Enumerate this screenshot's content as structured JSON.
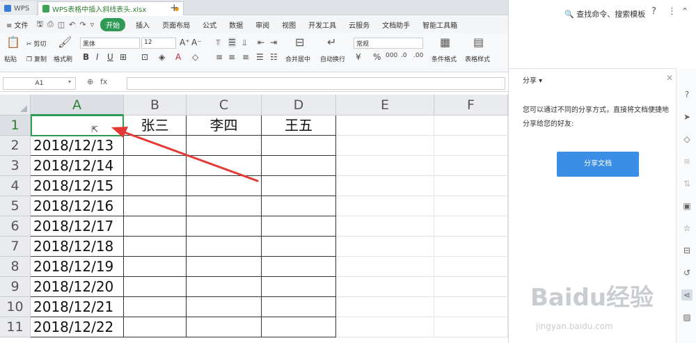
{
  "titlebar": {
    "wps_tab": "WPS",
    "file_tab": "WPS表格中插入斜线表头.xlsx",
    "new_tab": "+"
  },
  "menubar": {
    "file": "≡ 文件",
    "start": "开始",
    "items": [
      "插入",
      "页面布局",
      "公式",
      "数据",
      "审阅",
      "视图",
      "开发工具",
      "云服务",
      "文档助手",
      "智能工具箱"
    ]
  },
  "ribbon": {
    "paste": "粘贴",
    "cut": "剪切",
    "copy": "复制",
    "format_painter": "格式刷",
    "font_name": "黑体",
    "font_size": "12",
    "merge_center": "合并居中",
    "auto_wrap": "自动换行",
    "number_format": "常规",
    "cond_format": "条件格式",
    "table_style": "表格样式"
  },
  "formula": {
    "name_box": "A1",
    "fx": "fx"
  },
  "sheet": {
    "columns": [
      "A",
      "B",
      "C",
      "D",
      "E",
      "F"
    ],
    "rows": [
      "1",
      "2",
      "3",
      "4",
      "5",
      "6",
      "7",
      "8",
      "9",
      "10",
      "11"
    ],
    "header_row": [
      "",
      "张三",
      "李四",
      "王五"
    ],
    "dates": [
      "2018/12/13",
      "2018/12/14",
      "2018/12/15",
      "2018/12/16",
      "2018/12/17",
      "2018/12/18",
      "2018/12/19",
      "2018/12/20",
      "2018/12/21",
      "2018/12/22"
    ]
  },
  "sidepanel": {
    "search": "查找命令、搜索模板",
    "help": "?",
    "more": "⋮",
    "share_title": "分享",
    "share_desc": "您可以通过不同的分享方式，直接将文档便捷地分享给您的好友:",
    "share_button": "分享文档"
  },
  "watermark": {
    "brand": "Baidu经验",
    "url": "jingyan.baidu.com"
  },
  "colors": {
    "accent": "#2e9a55",
    "share_button": "#3a8ee6",
    "arrow": "#e53935"
  }
}
